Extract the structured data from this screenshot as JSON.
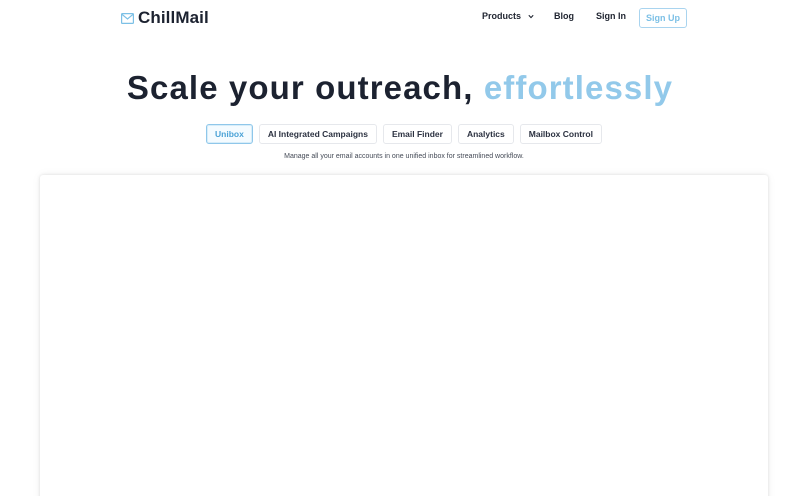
{
  "brand": {
    "name": "ChillMail",
    "icon": "envelope-icon",
    "accent_color": "#7cc0e6"
  },
  "nav": {
    "products_label": "Products",
    "blog_label": "Blog",
    "signin_label": "Sign In",
    "signup_label": "Sign Up"
  },
  "hero": {
    "title_main": "Scale your outreach,",
    "title_accent": "effortlessly"
  },
  "tabs": [
    {
      "label": "Unibox",
      "active": true
    },
    {
      "label": "AI Integrated Campaigns",
      "active": false
    },
    {
      "label": "Email Finder",
      "active": false
    },
    {
      "label": "Analytics",
      "active": false
    },
    {
      "label": "Mailbox Control",
      "active": false
    }
  ],
  "tab_description": "Manage all your email accounts in one unified inbox for streamlined workflow."
}
